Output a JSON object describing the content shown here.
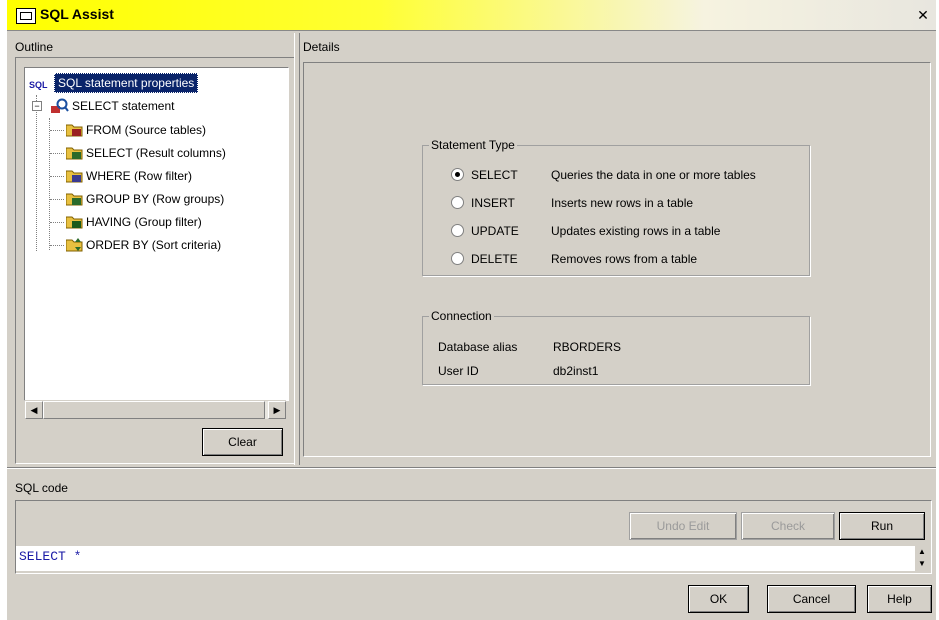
{
  "window": {
    "title": "SQL Assist"
  },
  "outline": {
    "label": "Outline",
    "tree": [
      {
        "label": "SQL statement properties",
        "selected": true,
        "icon": "sql-icon"
      },
      {
        "label": "SELECT statement",
        "icon": "query-icon"
      },
      {
        "label": "FROM (Source tables)",
        "icon": "folder-table-icon"
      },
      {
        "label": "SELECT (Result columns)",
        "icon": "folder-table-icon"
      },
      {
        "label": "WHERE (Row filter)",
        "icon": "folder-table-icon"
      },
      {
        "label": "GROUP BY (Row groups)",
        "icon": "folder-table-icon"
      },
      {
        "label": "HAVING (Group filter)",
        "icon": "folder-table-icon"
      },
      {
        "label": "ORDER BY (Sort criteria)",
        "icon": "folder-sort-icon"
      }
    ],
    "clear_button": "Clear"
  },
  "details": {
    "label": "Details",
    "statement_type": {
      "title": "Statement Type",
      "options": [
        {
          "label": "SELECT",
          "desc": "Queries the data in one or more tables",
          "selected": true
        },
        {
          "label": "INSERT",
          "desc": "Inserts new rows in a table",
          "selected": false
        },
        {
          "label": "UPDATE",
          "desc": "Updates existing rows in a table",
          "selected": false
        },
        {
          "label": "DELETE",
          "desc": "Removes rows from a table",
          "selected": false
        }
      ]
    },
    "connection": {
      "title": "Connection",
      "alias_label": "Database alias",
      "alias_value": "RBORDERS",
      "user_label": "User ID",
      "user_value": "db2inst1"
    }
  },
  "sql_code": {
    "label": "SQL code",
    "undo_button": "Undo Edit",
    "check_button": "Check",
    "run_button": "Run",
    "text": "SELECT *"
  },
  "footer": {
    "ok": "OK",
    "cancel": "Cancel",
    "help": "Help"
  },
  "colors": {
    "title_bar": "#ffff00",
    "selection": "#0a246a",
    "sql_keyword": "#1a1aa6"
  }
}
